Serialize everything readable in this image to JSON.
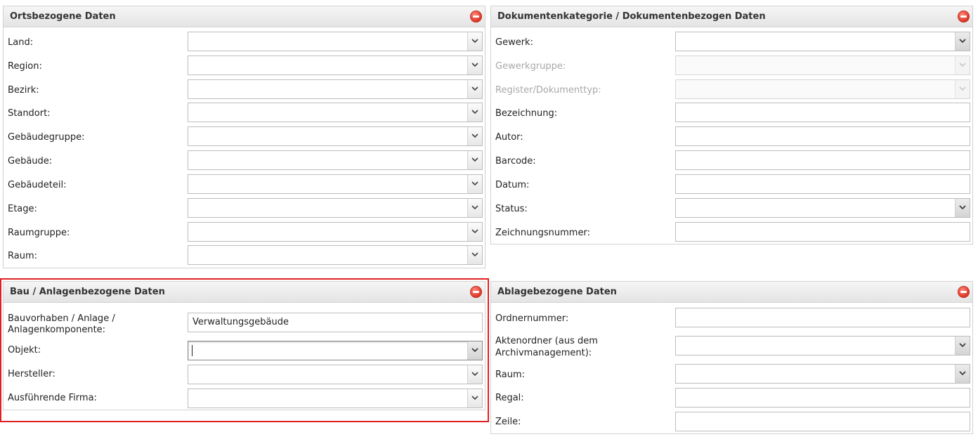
{
  "panels": {
    "location": {
      "title": "Ortsbezogene Daten",
      "fields": [
        {
          "label": "Land:",
          "value": ""
        },
        {
          "label": "Region:",
          "value": ""
        },
        {
          "label": "Bezirk:",
          "value": ""
        },
        {
          "label": "Standort:",
          "value": ""
        },
        {
          "label": "Gebäudegruppe:",
          "value": ""
        },
        {
          "label": "Gebäude:",
          "value": ""
        },
        {
          "label": "Gebäudeteil:",
          "value": ""
        },
        {
          "label": "Etage:",
          "value": ""
        },
        {
          "label": "Raumgruppe:",
          "value": ""
        },
        {
          "label": "Raum:",
          "value": ""
        }
      ]
    },
    "document": {
      "title": "Dokumentenkategorie / Dokumentenbezogen Daten",
      "fields": [
        {
          "label": "Gewerk:",
          "value": ""
        },
        {
          "label": "Gewerkgruppe:",
          "value": ""
        },
        {
          "label": "Register/Dokumenttyp:",
          "value": ""
        },
        {
          "label": "Bezeichnung:",
          "value": ""
        },
        {
          "label": "Autor:",
          "value": ""
        },
        {
          "label": "Barcode:",
          "value": ""
        },
        {
          "label": "Datum:",
          "value": ""
        },
        {
          "label": "Status:",
          "value": ""
        },
        {
          "label": "Zeichnungsnummer:",
          "value": ""
        }
      ]
    },
    "construction": {
      "title": "Bau / Anlagenbezogene Daten",
      "fields": [
        {
          "label": "Bauvorhaben / Anlage /",
          "label2": "Anlagenkomponente:",
          "value": "Verwaltungsgebäude"
        },
        {
          "label": "Objekt:",
          "value": ""
        },
        {
          "label": "Hersteller:",
          "value": ""
        },
        {
          "label": "Ausführende Firma:",
          "value": ""
        }
      ]
    },
    "filing": {
      "title": "Ablagebezogene Daten",
      "fields": [
        {
          "label": "Ordnernummer:",
          "value": ""
        },
        {
          "label": "Aktenordner (aus dem",
          "label2": "Archivmanagement):",
          "value": ""
        },
        {
          "label": "Raum:",
          "value": ""
        },
        {
          "label": "Regal:",
          "value": ""
        },
        {
          "label": "Zeile:",
          "value": ""
        }
      ]
    }
  },
  "colors": {
    "highlight": "#e02020",
    "collapse": "#e0392b"
  },
  "icons": {
    "collapse": "minus-circle-icon",
    "dropdown": "chevron-down-icon"
  }
}
